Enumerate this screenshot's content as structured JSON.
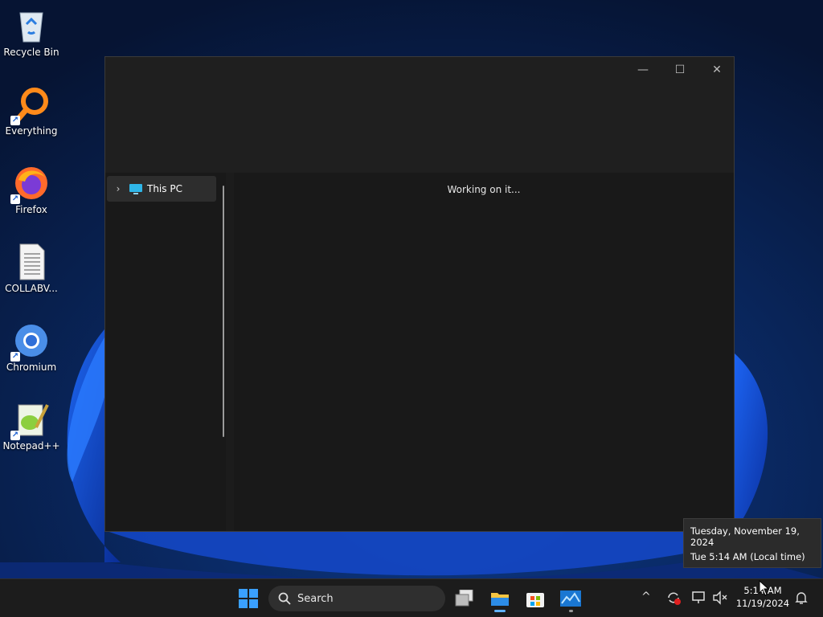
{
  "desktop": {
    "icons": [
      {
        "label": "Recycle Bin"
      },
      {
        "label": "Everything"
      },
      {
        "label": "Firefox"
      },
      {
        "label": "COLLABV..."
      },
      {
        "label": "Chromium"
      },
      {
        "label": "Notepad++"
      }
    ]
  },
  "explorer": {
    "controls": {
      "minimize": "—",
      "maximize": "☐",
      "close": "✕"
    },
    "nav": {
      "chevron": "›",
      "this_pc": "This PC"
    },
    "status": "Working on it..."
  },
  "tooltip": {
    "date": "Tuesday, November 19, 2024",
    "time": "Tue 5:14 AM (Local time)"
  },
  "taskbar": {
    "search_label": "Search",
    "clock_time": "5:14 AM",
    "clock_date": "11/19/2024",
    "tray_overflow": "^"
  }
}
